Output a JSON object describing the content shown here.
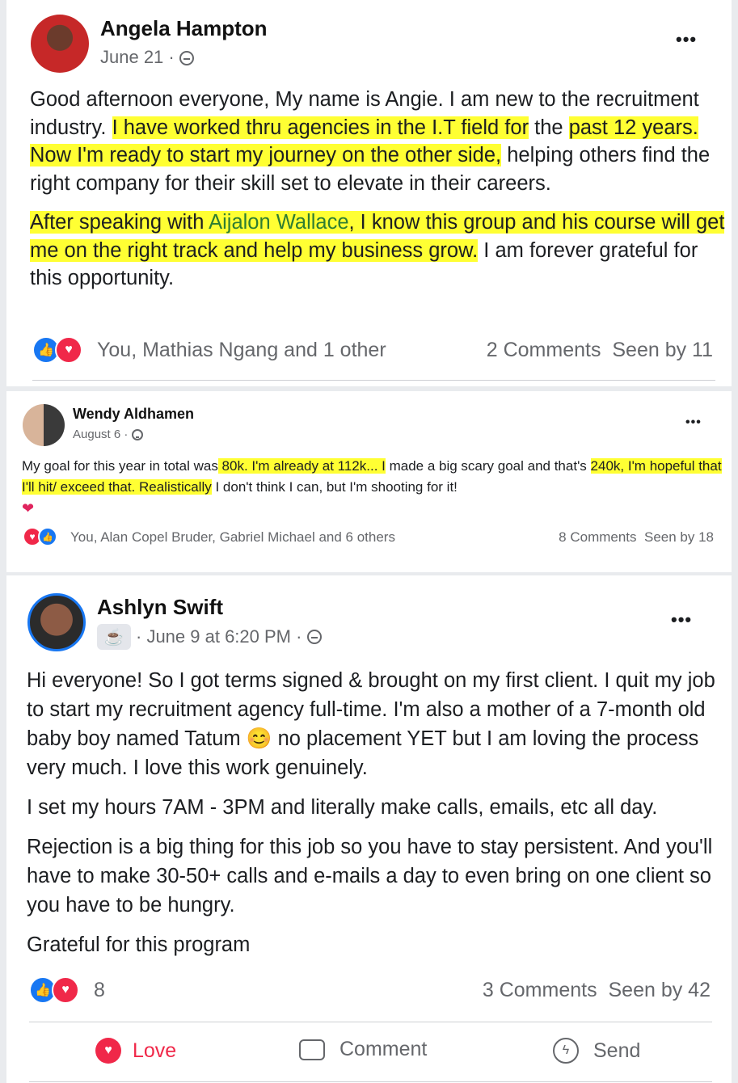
{
  "post1": {
    "author": "Angela Hampton",
    "date": "June 21 ·",
    "more_label": "•••",
    "p1_a": "Good afternoon everyone, My name is Angie. I am new to the recruitment industry. ",
    "p1_hl1": "I have worked thru agencies in the I.T field for",
    "p1_b": " the ",
    "p1_hl2": "past 12 years. Now I'm ready to start my journey on the other side,",
    "p1_c": " helping others find the right company for their skill set to elevate in their careers.",
    "p2_hl_a": "After speaking with ",
    "p2_mention": "Aijalon Wallace",
    "p2_hl_b": ", I know this group and his course will get me on the right track and help my business grow.",
    "p2_c": " I am forever grateful for this opportunity.",
    "reactions_text": "You, Mathias Ngang and 1 other",
    "comments": "2 Comments",
    "seen": "Seen by 11"
  },
  "post2": {
    "author": "Wendy Aldhamen",
    "date": "August 6 ·",
    "more_label": "•••",
    "t_a": "My goal for this year in total was",
    "t_hl1": " 80k. I'm already at 112k... I",
    "t_b": " made a big scary goal and that's ",
    "t_hl2": "240k, I'm hopeful that I'll hit/ exceed that. Realistically",
    "t_c": " I don't think I can, but I'm shooting for it!",
    "heart": "❤",
    "reactions_text": "You, Alan Copel Bruder, Gabriel Michael and 6 others",
    "comments": "8 Comments",
    "seen": "Seen by 18"
  },
  "post3": {
    "author": "Ashlyn Swift",
    "date": "· June 9 at 6:20 PM ·",
    "more_label": "•••",
    "badge_icon": "coffee-cup-icon",
    "p1": "Hi everyone! So I got terms signed & brought on my first client. I quit my job to start my recruitment agency full-time. I'm also a mother of a 7-month old baby boy named Tatum",
    "emoji": "😊",
    "p1_end": " no placement YET but I am loving the process very much. I love this work genuinely.",
    "p2": "I set my hours 7AM - 3PM and literally make calls, emails, etc all day.",
    "p3": "Rejection is a big thing for this job so you have to stay persistent. And you'll have to make 30-50+ calls and e-mails a day to even bring on one client so you have to be hungry.",
    "p4": "Grateful for this program",
    "reactions_count": "8",
    "comments": "3 Comments",
    "seen": "Seen by 42",
    "actions": {
      "love": "Love",
      "comment": "Comment",
      "send": "Send"
    }
  },
  "colors": {
    "highlight": "#ffff33",
    "mention": "#2e7d32",
    "like": "#1877f2",
    "love": "#f02849"
  }
}
